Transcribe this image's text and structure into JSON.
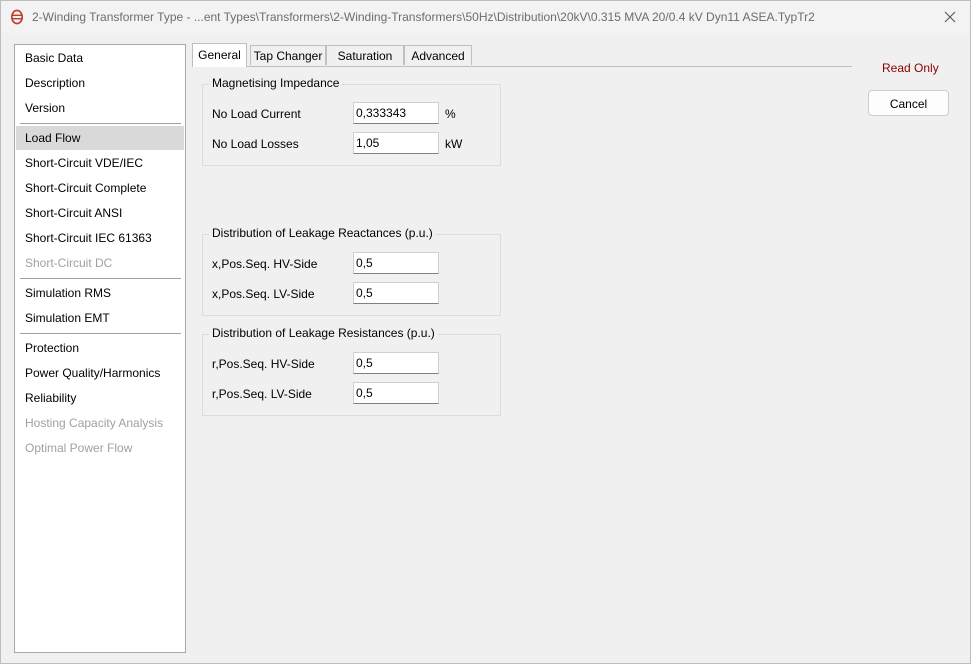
{
  "window": {
    "title": "2-Winding Transformer Type - ...ent Types\\Transformers\\2-Winding-Transformers\\50Hz\\Distribution\\20kV\\0.315 MVA 20/0.4 kV Dyn11 ASEA.TypTr2",
    "close_glyph": "✕"
  },
  "sidebar": {
    "items": [
      {
        "label": "Basic Data",
        "state": "normal"
      },
      {
        "label": "Description",
        "state": "normal"
      },
      {
        "label": "Version",
        "state": "normal"
      },
      {
        "label": "Load Flow",
        "state": "selected"
      },
      {
        "label": "Short-Circuit VDE/IEC",
        "state": "normal"
      },
      {
        "label": "Short-Circuit Complete",
        "state": "normal"
      },
      {
        "label": "Short-Circuit ANSI",
        "state": "normal"
      },
      {
        "label": "Short-Circuit IEC 61363",
        "state": "normal"
      },
      {
        "label": "Short-Circuit DC",
        "state": "disabled"
      },
      {
        "label": "Simulation RMS",
        "state": "normal"
      },
      {
        "label": "Simulation EMT",
        "state": "normal"
      },
      {
        "label": "Protection",
        "state": "normal"
      },
      {
        "label": "Power Quality/Harmonics",
        "state": "normal"
      },
      {
        "label": "Reliability",
        "state": "normal"
      },
      {
        "label": "Hosting Capacity Analysis",
        "state": "disabled"
      },
      {
        "label": "Optimal Power Flow",
        "state": "disabled"
      }
    ]
  },
  "tabs": [
    {
      "label": "General",
      "active": true
    },
    {
      "label": "Tap Changer",
      "active": false
    },
    {
      "label": "Saturation",
      "active": false
    },
    {
      "label": "Advanced",
      "active": false
    }
  ],
  "magnetising": {
    "title": "Magnetising Impedance",
    "no_load_current_label": "No Load Current",
    "no_load_current_value": "0,333343",
    "no_load_current_unit": "%",
    "no_load_losses_label": "No Load Losses",
    "no_load_losses_value": "1,05",
    "no_load_losses_unit": "kW"
  },
  "reactances": {
    "title": "Distribution of Leakage Reactances (p.u.)",
    "hv_label": "x,Pos.Seq. HV-Side",
    "hv_value": "0,5",
    "lv_label": "x,Pos.Seq. LV-Side",
    "lv_value": "0,5"
  },
  "resistances": {
    "title": "Distribution of Leakage Resistances (p.u.)",
    "hv_label": "r,Pos.Seq. HV-Side",
    "hv_value": "0,5",
    "lv_label": "r,Pos.Seq. LV-Side",
    "lv_value": "0,5"
  },
  "right_panel": {
    "read_only": "Read Only",
    "cancel": "Cancel",
    "read_only_color": "#8b0000"
  },
  "icons": {
    "app": "powerfactory-app-icon",
    "close": "close-icon"
  },
  "colors": {
    "accent": "#c0392b",
    "selected_item_bg": "#d9d9d9",
    "disabled_text": "#a0a0a0"
  }
}
